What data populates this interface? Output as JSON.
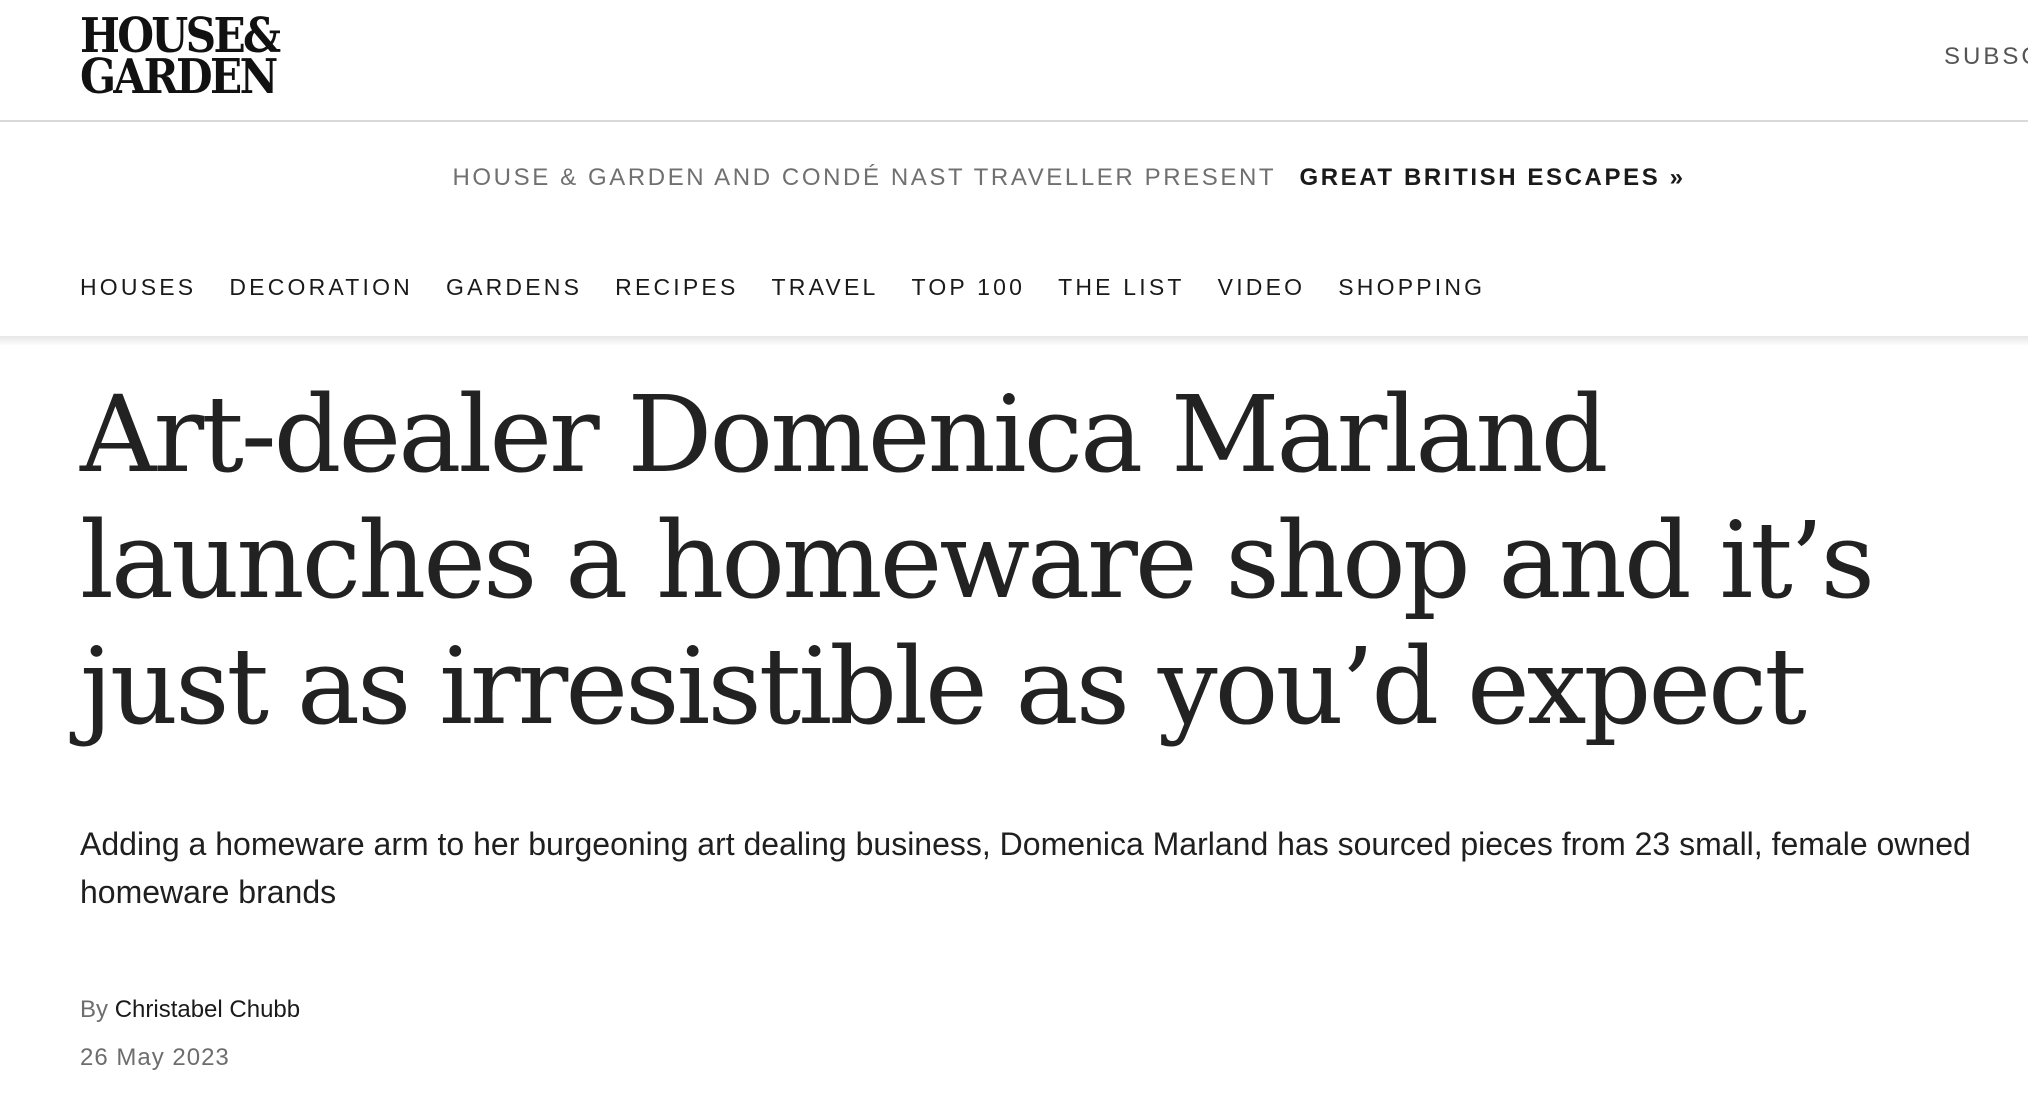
{
  "header": {
    "logo_line1": "House&",
    "logo_line2": "Garden",
    "subscribe_label": "SUBSC"
  },
  "promo": {
    "text": "HOUSE & GARDEN AND CONDÉ NAST TRAVELLER PRESENT",
    "link_label": "GREAT BRITISH ESCAPES »"
  },
  "nav": {
    "items": [
      {
        "label": "HOUSES"
      },
      {
        "label": "DECORATION"
      },
      {
        "label": "GARDENS"
      },
      {
        "label": "RECIPES"
      },
      {
        "label": "TRAVEL"
      },
      {
        "label": "TOP 100"
      },
      {
        "label": "THE LIST"
      },
      {
        "label": "VIDEO"
      },
      {
        "label": "SHOPPING"
      }
    ]
  },
  "article": {
    "headline": "Art-dealer Domenica Marland launches a homeware shop and it’s just as irresistible as you’d expect",
    "dek": "Adding a homeware arm to her burgeoning art dealing business, Domenica Marland has sourced pieces from 23 small, female owned homeware brands",
    "byline_prefix": "By",
    "author": "Christabel Chubb",
    "date": "26 May 2023"
  }
}
